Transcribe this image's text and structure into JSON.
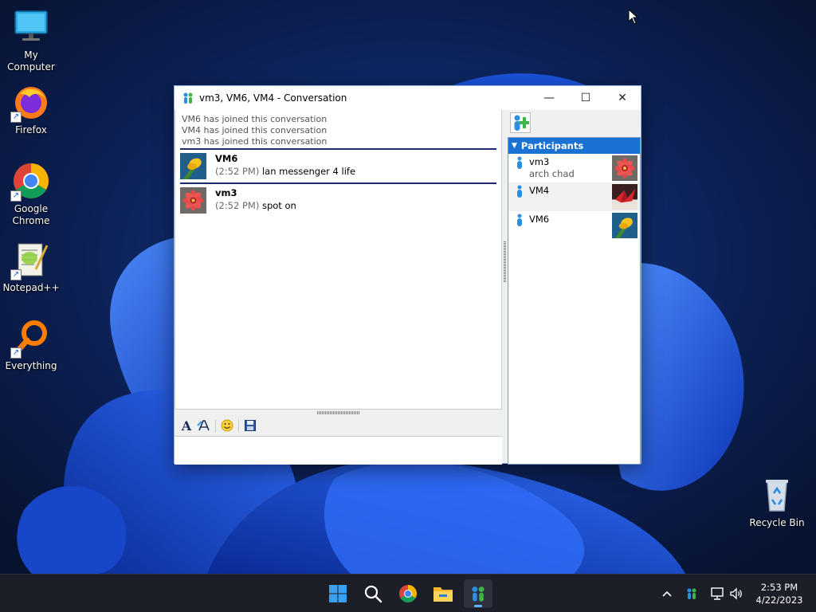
{
  "desktop": {
    "icons": [
      {
        "label": "My Computer",
        "icon": "monitor-icon"
      },
      {
        "label": "Firefox",
        "icon": "firefox-icon"
      },
      {
        "label": "Google Chrome",
        "icon": "chrome-icon"
      },
      {
        "label": "Notepad++",
        "icon": "notepadpp-icon"
      },
      {
        "label": "Everything",
        "icon": "search-magnifier-icon"
      }
    ],
    "recycle_bin": {
      "label": "Recycle Bin",
      "icon": "recycle-bin-icon"
    }
  },
  "window": {
    "title": "vm3, VM6, VM4 - Conversation",
    "controls": {
      "minimize": "—",
      "maximize": "☐",
      "close": "✕"
    },
    "system_messages": [
      "VM6 has joined this conversation",
      "VM4 has joined this conversation",
      "vm3 has joined this conversation"
    ],
    "messages": [
      {
        "sender": "VM6",
        "time": "(2:52 PM)",
        "text": "lan messenger 4 life",
        "avatar": "yellow-flower-avatar"
      },
      {
        "sender": "vm3",
        "time": "(2:52 PM)",
        "text": "spot on",
        "avatar": "red-flower-avatar"
      }
    ],
    "toolbar": {
      "font": "A",
      "icons": [
        "font-icon",
        "font-style-icon",
        "smiley-icon",
        "save-icon"
      ]
    },
    "input": {
      "value": ""
    },
    "participants": {
      "header": "Participants",
      "items": [
        {
          "name": "vm3",
          "status": "arch chad",
          "avatar": "red-flower-avatar"
        },
        {
          "name": "VM4",
          "status": "",
          "avatar": "origami-crane-avatar"
        },
        {
          "name": "VM6",
          "status": "",
          "avatar": "yellow-flower-avatar"
        }
      ]
    }
  },
  "taskbar": {
    "apps": [
      "windows-start-icon",
      "search-icon",
      "chrome-icon",
      "file-explorer-icon",
      "lan-messenger-icon"
    ],
    "tray": [
      "chevron-up-icon",
      "lan-messenger-tray-icon",
      "network-icon",
      "volume-icon"
    ],
    "time": "2:53 PM",
    "date": "4/22/2023"
  },
  "colors": {
    "participants_header": "#1a72d4",
    "message_separator": "#1c2a6b",
    "wallpaper_dark": "#0b1a3e",
    "wallpaper_bloom": "#1f5ae8"
  }
}
